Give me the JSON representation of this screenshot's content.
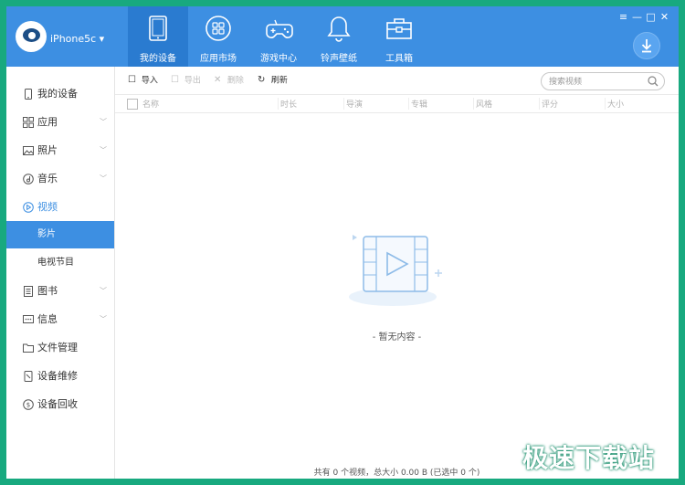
{
  "header": {
    "device_name": "iPhone5c ▾",
    "tabs": [
      {
        "label": "我的设备",
        "icon": "tablet-icon"
      },
      {
        "label": "应用市场",
        "icon": "apps-icon"
      },
      {
        "label": "游戏中心",
        "icon": "gamepad-icon"
      },
      {
        "label": "铃声壁纸",
        "icon": "bell-icon"
      },
      {
        "label": "工具箱",
        "icon": "toolbox-icon"
      }
    ],
    "window_controls": [
      "≡",
      "—",
      "□",
      "✕"
    ],
    "accent_color": "#3d8fe2"
  },
  "sidebar": {
    "items": [
      {
        "label": "我的设备",
        "icon": "phone-icon"
      },
      {
        "label": "应用",
        "icon": "apps-grid-icon",
        "chevron": "﹀"
      },
      {
        "label": "照片",
        "icon": "photo-icon",
        "chevron": "﹀"
      },
      {
        "label": "音乐",
        "icon": "music-icon",
        "chevron": "﹀"
      },
      {
        "label": "视频",
        "icon": "video-icon"
      },
      {
        "label": "图书",
        "icon": "book-icon",
        "chevron": "﹀"
      },
      {
        "label": "信息",
        "icon": "message-icon",
        "chevron": "﹀"
      },
      {
        "label": "文件管理",
        "icon": "folder-icon"
      },
      {
        "label": "设备维修",
        "icon": "repair-icon"
      },
      {
        "label": "设备回收",
        "icon": "recycle-icon"
      }
    ],
    "video_sub": [
      {
        "label": "影片",
        "selected": true
      },
      {
        "label": "电视节目",
        "selected": false
      }
    ]
  },
  "toolbar": {
    "import_label": "导入",
    "export_label": "导出",
    "delete_label": "删除",
    "refresh_label": "刷新",
    "search_placeholder": "搜索视频"
  },
  "table": {
    "columns": [
      "名称",
      "时长",
      "导演",
      "专辑",
      "风格",
      "评分",
      "大小"
    ]
  },
  "empty_state": "- 暂无内容 -",
  "status_bar": "共有 0 个视频，总大小 0.00 B (已选中 0 个)",
  "watermark": "极速下载站"
}
